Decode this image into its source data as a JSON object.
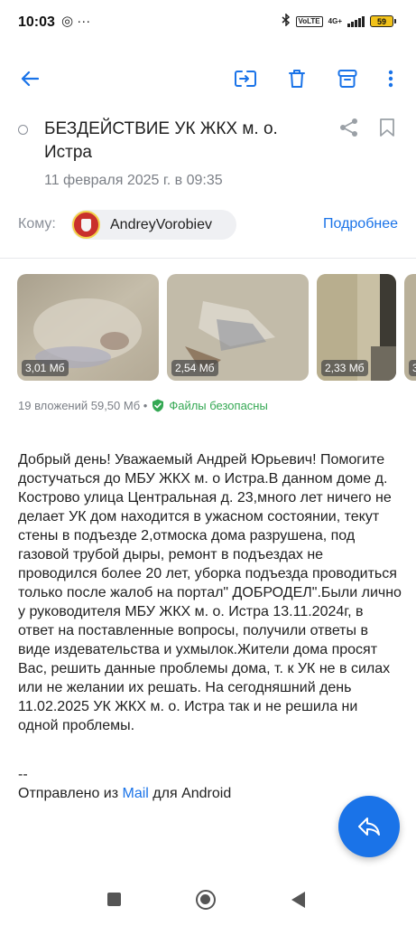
{
  "status_bar": {
    "time": "10:03",
    "left_icons": "◎ ···",
    "volte": "VoLTE",
    "network": "4G+",
    "battery": "59"
  },
  "toolbar": {
    "back": "back-arrow-icon",
    "actions": [
      "move-to-folder-icon",
      "trash-icon",
      "archive-icon",
      "more-vert-icon"
    ],
    "accent": "#1a73e8"
  },
  "message": {
    "subject": "БЕЗДЕЙСТВИЕ УК ЖКХ м. о. Истра",
    "date": "11 февраля 2025 г. в 09:35",
    "to_label": "Кому:",
    "recipient": "AndreyVorobiev",
    "more_link": "Подробнее"
  },
  "attachments": {
    "items": [
      {
        "size": "3,01 Мб"
      },
      {
        "size": "2,54 Мб"
      },
      {
        "size": "2,33 Мб"
      },
      {
        "size": "3"
      }
    ],
    "summary": "19 вложений 59,50 Мб •",
    "safe_label": "Файлы безопасны"
  },
  "body": {
    "text": "Добрый день! Уважаемый Андрей Юрьевич! Помогите достучаться до МБУ ЖКХ м. о Истра.В данном доме д. Кострово улица Центральная д. 23,много лет ничего не делает УК дом находится в ужасном состоянии, текут стены в подъезде 2,отмоска дома разрушена, под газовой трубой дыры, ремонт в подъездах не проводился более 20 лет, уборка подъезда проводиться только после жалоб на портал\" ДОБРОДЕЛ\".Были лично у руководителя МБУ ЖКХ м. о. Истра 13.11.2024г, в ответ на поставленные вопросы, получили ответы в виде издевательства и ухмылок.Жители дома просят Вас, решить данные проблемы дома, т. к УК не в силах или не желании их решать. На сегодняшний день 11.02.2025 УК ЖКХ м. о. Истра так и не решила ни одной проблемы.",
    "signature_dash": "--",
    "signature_prefix": "Отправлено из ",
    "signature_link": "Mail",
    "signature_suffix": " для Android"
  },
  "fab": {
    "icon": "reply-icon"
  },
  "nav": {
    "icons": [
      "recents-square-icon",
      "home-circle-icon",
      "back-triangle-icon"
    ]
  }
}
